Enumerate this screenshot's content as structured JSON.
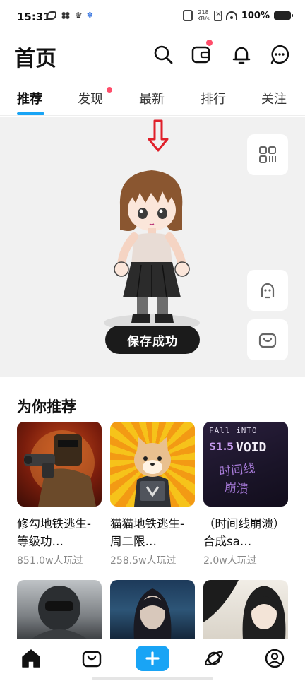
{
  "status_bar": {
    "time": "15:31",
    "net_speed_top": "218",
    "net_speed_bottom": "KB/s",
    "battery": "100%"
  },
  "header": {
    "title": "首页",
    "icons": [
      "search-icon",
      "wallet-icon",
      "bell-icon",
      "chat-icon"
    ]
  },
  "tabs": [
    {
      "label": "推荐",
      "active": true
    },
    {
      "label": "发现",
      "badge": true
    },
    {
      "label": "最新"
    },
    {
      "label": "排行"
    },
    {
      "label": "关注"
    }
  ],
  "hero": {
    "arrow": "⇩",
    "toast": "保存成功",
    "side_buttons": [
      "qr-code-icon",
      "avatar-face-icon",
      "shop-bag-icon"
    ]
  },
  "recommend": {
    "title": "为你推荐",
    "items": [
      {
        "title": "修勾地铁逃生-等级功…",
        "players": "851.0w人玩过"
      },
      {
        "title": "猫猫地铁逃生-周二限…",
        "players": "258.5w人玩过"
      },
      {
        "title": "（时间线崩溃）合成sa…",
        "players": "2.0w人玩过"
      }
    ],
    "thumb3_text": {
      "line1": "FAll iNTO",
      "line2": "VOID",
      "line3": "时间线",
      "line4": "崩溃",
      "badge": "S1.5"
    }
  },
  "bottom_nav": [
    "home-icon",
    "shop-bag-icon",
    "plus-icon",
    "planet-icon",
    "profile-icon"
  ],
  "colors": {
    "accent": "#19a4f5",
    "badge_red": "#ff4d6a",
    "hero_bg": "#f1f1f1",
    "arrow_red": "#e0202a"
  }
}
